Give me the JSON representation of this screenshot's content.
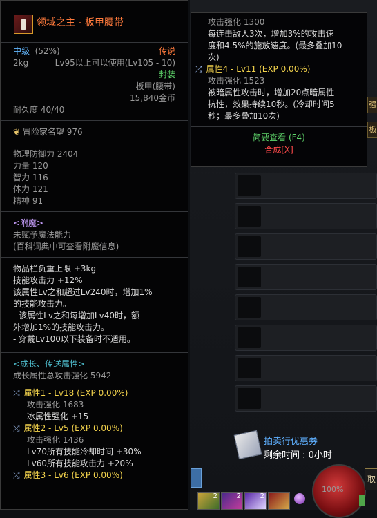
{
  "item": {
    "name": "领域之主 - 板甲腰带",
    "grade": "中级",
    "grade_percent": "(52%)",
    "rarity": "传说",
    "weight": "2kg",
    "level_req": "Lv95以上可以使用(Lv105 - 10)",
    "sealed": "封装",
    "type": "板甲(腰带)",
    "price": "15,840金币",
    "durability": "耐久度 40/40"
  },
  "fame": {
    "label": "冒险家名望",
    "value": "976"
  },
  "stats": [
    {
      "label": "物理防御力",
      "value": "2404"
    },
    {
      "label": "力量",
      "value": "120"
    },
    {
      "label": "智力",
      "value": "116"
    },
    {
      "label": "体力",
      "value": "121"
    },
    {
      "label": "精神",
      "value": "91"
    }
  ],
  "enchant": {
    "title": "<附魔>",
    "line1": "未赋予魔法能力",
    "line2": "(百科词典中可查看附魔信息)"
  },
  "options": {
    "lines": [
      "物品栏负重上限 +3kg",
      "技能攻击力 +12%",
      "该属性Lv之和超过Lv240时，增加1%",
      "的技能攻击力。",
      "- 该属性Lv之和每增加Lv40时，额",
      "外增加1%的技能攻击力。",
      "- 穿戴Lv100以下装备时不适用。"
    ]
  },
  "growth": {
    "title": "<成长、传送属性>",
    "total": "成长属性总攻击强化 5942",
    "attrs": [
      {
        "title": "属性1 - Lv18 (EXP 0.00%)",
        "lines": [
          "攻击强化 1683",
          "冰属性强化 +15"
        ]
      },
      {
        "title": "属性2 - Lv5 (EXP 0.00%)",
        "lines": [
          "攻击强化 1436",
          "Lv70所有技能冷却时间 +30%",
          "Lv60所有技能攻击力 +20%"
        ]
      },
      {
        "title": "属性3 - Lv6 (EXP 0.00%)",
        "lines": []
      }
    ]
  },
  "tooltip2": {
    "line_a": "攻击强化 1300",
    "desc1": [
      "每连击敌人3次，增加3%的攻击速",
      "度和4.5%的施放速度。(最多叠加10",
      "次)"
    ],
    "attr4_title": "属性4 - Lv11 (EXP 0.00%)",
    "line_b": "攻击强化 1523",
    "desc2": [
      "被暗属性攻击时，增加20点暗属性",
      "抗性，效果持续10秒。(冷却时间5",
      "秒；最多叠加10次)"
    ],
    "brief_view": "简要查看 (F4)",
    "synthesis": "合成[X]"
  },
  "background": {
    "coupon_title": "拍卖行优惠券",
    "coupon_time": "剩余时间 : 0小时",
    "right_button": "取",
    "orb_text": "100%",
    "hotbar_counts": [
      "2",
      "2",
      "2"
    ],
    "side_tab_1": "强",
    "side_tab_2": "板"
  }
}
